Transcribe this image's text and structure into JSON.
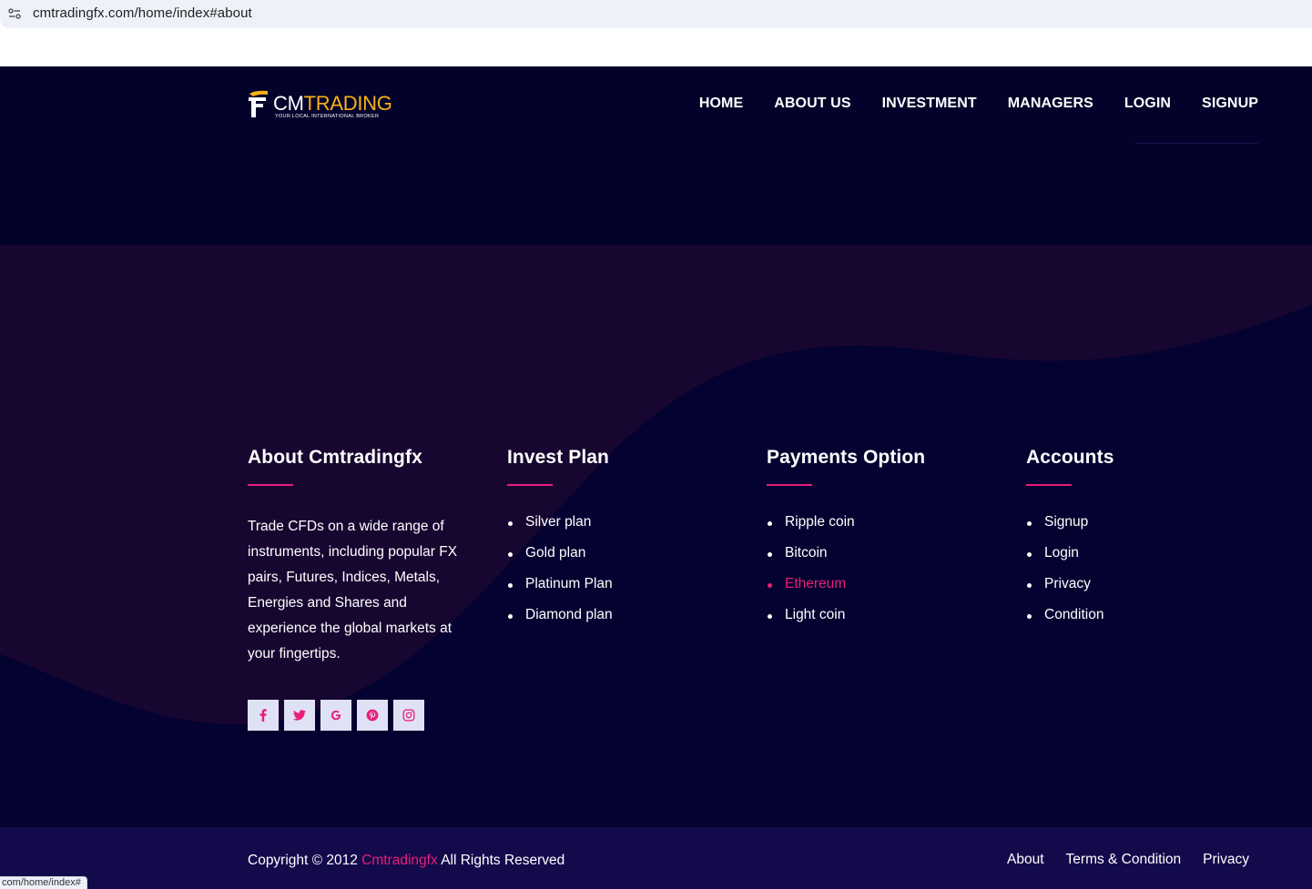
{
  "browser": {
    "url": "cmtradingfx.com/home/index#about",
    "status_url": "com/home/index#"
  },
  "header": {
    "logo": {
      "brand_cm": "CM",
      "brand_trading": "TRADING",
      "tagline": "YOUR LOCAL INTERNATIONAL BROKER"
    },
    "nav": [
      "HOME",
      "ABOUT US",
      "INVESTMENT",
      "MANAGERS",
      "LOGIN",
      "SIGNUP"
    ]
  },
  "footer": {
    "about": {
      "title": "About Cmtradingfx",
      "text": "Trade CFDs on a wide range of instruments, including popular FX pairs, Futures, Indices, Metals, Energies and Shares and experience the global markets at your fingertips."
    },
    "socials": [
      {
        "icon": "facebook-icon"
      },
      {
        "icon": "twitter-icon"
      },
      {
        "icon": "google-icon"
      },
      {
        "icon": "pinterest-icon"
      },
      {
        "icon": "instagram-icon"
      }
    ],
    "invest_plan": {
      "title": "Invest Plan",
      "items": [
        "Silver plan",
        "Gold plan",
        "Platinum Plan",
        "Diamond plan"
      ]
    },
    "payments": {
      "title": "Payments Option",
      "items": [
        "Ripple coin",
        "Bitcoin",
        "Ethereum",
        "Light coin"
      ],
      "active_item": "Ethereum"
    },
    "accounts": {
      "title": "Accounts",
      "items": [
        "Signup",
        "Login",
        "Privacy",
        "Condition"
      ]
    }
  },
  "bottom_bar": {
    "copyright_prefix": "Copyright © 2012",
    "brand": "Cmtradingfx",
    "copyright_suffix": "All Rights Reserved",
    "links": [
      "About",
      "Terms & Condition",
      "Privacy"
    ]
  },
  "colors": {
    "accent": "#e91e79",
    "header_bg": "#03022b",
    "footer_bg": "#030230",
    "wave_bg": "#170630",
    "bottom_bg": "#130a4c",
    "logo_gold": "#f6b316"
  }
}
